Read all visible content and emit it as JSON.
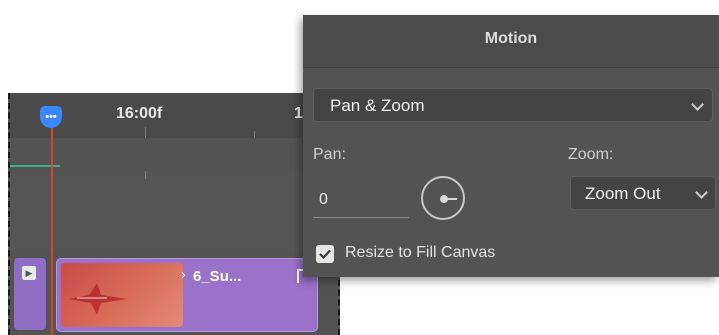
{
  "timeline": {
    "timecode": "16:00f",
    "timecode_next": "1",
    "playhead_icon": "•••",
    "clip_title": "6_Su..."
  },
  "motion_panel": {
    "title": "Motion",
    "mode_value": "Pan & Zoom",
    "pan_label": "Pan:",
    "pan_value": "0",
    "zoom_label": "Zoom:",
    "zoom_value": "Zoom Out",
    "resize_label": "Resize to Fill Canvas",
    "resize_checked": true
  },
  "icons": {
    "playhead": "playhead-marker-icon",
    "track": "track-menu-icon",
    "chevron": "chevron-down-icon",
    "dial": "angle-dial-icon",
    "check": "checkmark-icon",
    "clip_expand": "chevron-right-icon"
  },
  "colors": {
    "panel_bg": "#535353",
    "panel_header": "#4b4b4b",
    "playhead": "#3a86ff",
    "playhead_line": "#d8452e",
    "clip": "#9a72c9",
    "marker_green": "#3fae84"
  }
}
